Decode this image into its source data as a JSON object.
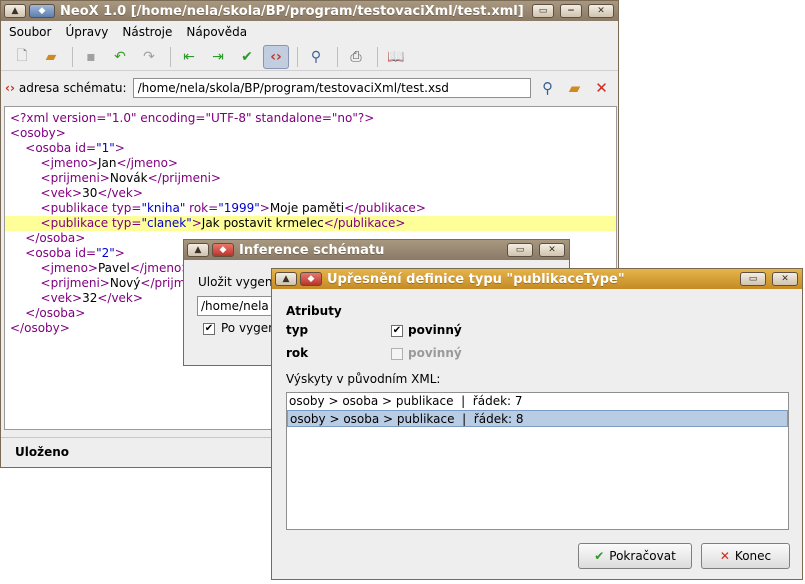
{
  "main_window": {
    "title": "NeoX 1.0 [/home/nela/skola/BP/program/testovaciXml/test.xml]",
    "menu": [
      "Soubor",
      "Úpravy",
      "Nástroje",
      "Nápověda"
    ],
    "schema_label": "adresa schématu:",
    "schema_path": "/home/nela/skola/BP/program/testovaciXml/test.xsd",
    "status": "Uloženo"
  },
  "xml": {
    "decl": "<?xml version=\"1.0\" encoding=\"UTF-8\" standalone=\"no\"?>",
    "l1": "<osoby>",
    "l2a": "<osoba",
    "l2b": " id=",
    "l2c": "\"1\"",
    "l2d": ">",
    "l3a": "<jmeno>",
    "l3b": "Jan",
    "l3c": "</jmeno>",
    "l4a": "<prijmeni>",
    "l4b": "Novák",
    "l4c": "</prijmeni>",
    "l5a": "<vek>",
    "l5b": "30",
    "l5c": "</vek>",
    "l6a": "<publikace",
    "l6b": " typ=",
    "l6c": "\"kniha\"",
    "l6d": " rok=",
    "l6e": "\"1999\"",
    "l6f": ">",
    "l6g": "Moje paměti",
    "l6h": "</publikace>",
    "l7a": "<publikace",
    "l7b": " typ=",
    "l7c": "\"clanek\"",
    "l7d": ">",
    "l7e": "Jak postavit krmelec",
    "l7f": "</publikace>",
    "l8": "</osoba>",
    "l9a": "<osoba",
    "l9b": " id=",
    "l9c": "\"2\"",
    "l9d": ">",
    "l10a": "<jmeno>",
    "l10b": "Pavel",
    "l10c": "</jmeno>",
    "l11a": "<prijmeni>",
    "l11b": "Nový",
    "l11c": "</prijm",
    "l12a": "<vek>",
    "l12b": "32",
    "l12c": "</vek>",
    "l13": "</osoba>",
    "l14": "</osoby>"
  },
  "inference_dialog": {
    "title": "Inference schématu",
    "save_label": "Uložit vygene",
    "path_value": "/home/nela",
    "checkbox_label": "Po vygen"
  },
  "type_dialog": {
    "title": "Upřesnění definice typu \"publikaceType\"",
    "attributes_heading": "Atributy",
    "attr_typ": "typ",
    "attr_typ_required": "povinný",
    "attr_rok": "rok",
    "attr_rok_required": "povinný",
    "occurrences_label": "Výskyty v původním XML:",
    "occurrences": [
      "osoby > osoba > publikace  |  řádek: 7",
      "osoby > osoba > publikace  |  řádek: 8"
    ],
    "continue_label": "Pokračovat",
    "cancel_label": "Konec"
  }
}
